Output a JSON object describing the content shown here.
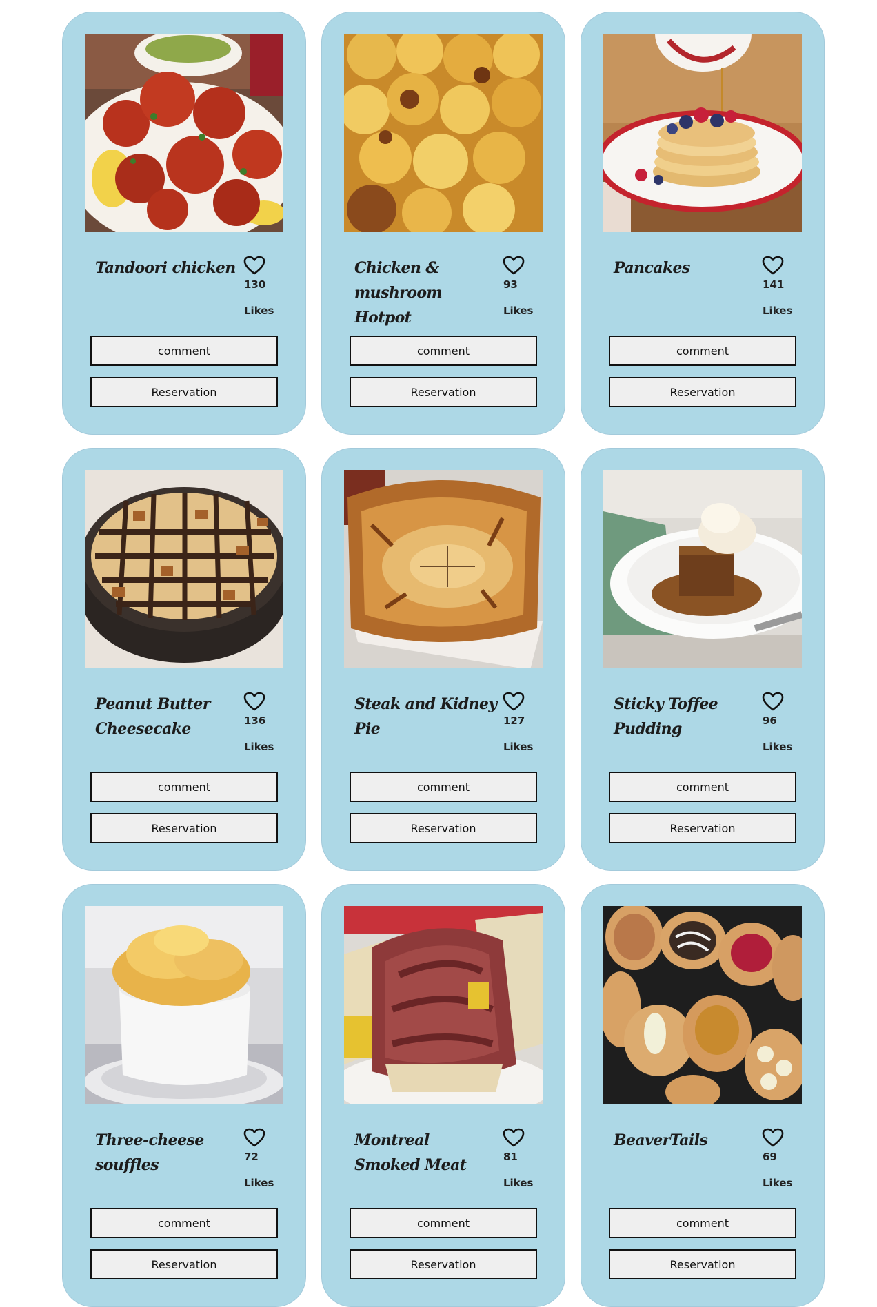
{
  "meals": [
    {
      "title": "Tandoori chicken",
      "likes": "130",
      "likes_label": "Likes",
      "comment_label": "comment",
      "reservation_label": "Reservation",
      "image": "tandoori-chicken-photo"
    },
    {
      "title": "Chicken & mushroom Hotpot",
      "likes": "93",
      "likes_label": "Likes",
      "comment_label": "comment",
      "reservation_label": "Reservation",
      "image": "chicken-mushroom-hotpot-photo"
    },
    {
      "title": "Pancakes",
      "likes": "141",
      "likes_label": "Likes",
      "comment_label": "comment",
      "reservation_label": "Reservation",
      "image": "pancakes-photo"
    },
    {
      "title": "Peanut Butter Cheesecake",
      "likes": "136",
      "likes_label": "Likes",
      "comment_label": "comment",
      "reservation_label": "Reservation",
      "image": "peanut-butter-cheesecake-photo"
    },
    {
      "title": "Steak and Kidney Pie",
      "likes": "127",
      "likes_label": "Likes",
      "comment_label": "comment",
      "reservation_label": "Reservation",
      "image": "steak-kidney-pie-photo"
    },
    {
      "title": "Sticky Toffee Pudding",
      "likes": "96",
      "likes_label": "Likes",
      "comment_label": "comment",
      "reservation_label": "Reservation",
      "image": "sticky-toffee-pudding-photo"
    },
    {
      "title": "Three-cheese souffles",
      "likes": "72",
      "likes_label": "Likes",
      "comment_label": "comment",
      "reservation_label": "Reservation",
      "image": "three-cheese-souffle-photo"
    },
    {
      "title": "Montreal Smoked Meat",
      "likes": "81",
      "likes_label": "Likes",
      "comment_label": "comment",
      "reservation_label": "Reservation",
      "image": "montreal-smoked-meat-photo"
    },
    {
      "title": "BeaverTails",
      "likes": "69",
      "likes_label": "Likes",
      "comment_label": "comment",
      "reservation_label": "Reservation",
      "image": "beavertails-photo"
    }
  ],
  "colors": {
    "card_background": "#add8e6",
    "button_background": "#efefef",
    "button_border": "#111111"
  },
  "icons": {
    "like": "heart-outline-icon"
  }
}
